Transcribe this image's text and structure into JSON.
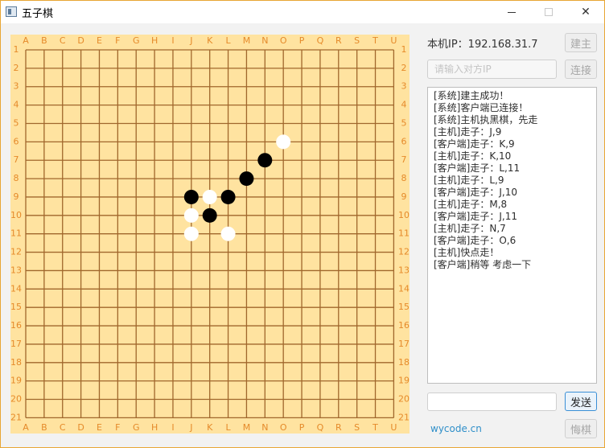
{
  "window": {
    "title": "五子棋",
    "minimize_icon": "minimize-icon",
    "maximize_icon": "maximize-icon",
    "close_icon": "close-icon",
    "close_glyph": "✕"
  },
  "board": {
    "columns": [
      "A",
      "B",
      "C",
      "D",
      "E",
      "F",
      "G",
      "H",
      "I",
      "J",
      "K",
      "L",
      "M",
      "N",
      "O",
      "P",
      "Q",
      "R",
      "S",
      "T",
      "U"
    ],
    "rows": [
      "1",
      "2",
      "3",
      "4",
      "5",
      "6",
      "7",
      "8",
      "9",
      "10",
      "11",
      "12",
      "13",
      "14",
      "15",
      "16",
      "17",
      "18",
      "19",
      "20",
      "21"
    ],
    "background_color": "#ffe3a0",
    "line_color": "#a0672c",
    "label_color": "#e58a2a",
    "stones": [
      {
        "color": "white",
        "col": "O",
        "row": 6
      },
      {
        "color": "black",
        "col": "N",
        "row": 7
      },
      {
        "color": "black",
        "col": "M",
        "row": 8
      },
      {
        "color": "black",
        "col": "J",
        "row": 9
      },
      {
        "color": "white",
        "col": "K",
        "row": 9
      },
      {
        "color": "black",
        "col": "L",
        "row": 9
      },
      {
        "color": "white",
        "col": "J",
        "row": 10
      },
      {
        "color": "black",
        "col": "K",
        "row": 10
      },
      {
        "color": "white",
        "col": "J",
        "row": 11
      },
      {
        "color": "white",
        "col": "L",
        "row": 11
      }
    ]
  },
  "sidebar": {
    "ip_label": "本机IP：192.168.31.7",
    "host_button": "建主",
    "ip_placeholder": "请输入对方IP",
    "connect_button": "连接",
    "log": [
      "[系统]建主成功！",
      "[系统]客户端已连接！",
      "[系统]主机执黑棋，先走",
      "[主机]走子：J,9",
      "[客户端]走子：K,9",
      "[主机]走子：K,10",
      "[客户端]走子：L,11",
      "[主机]走子：L,9",
      "[客户端]走子：J,10",
      "[主机]走子：M,8",
      "[客户端]走子：J,11",
      "[主机]走子：N,7",
      "[客户端]走子：O,6",
      "[主机]快点走！",
      "[客户端]稍等 考虑一下"
    ],
    "message_value": "",
    "send_button": "发送",
    "footer_link": "wycode.cn",
    "undo_button": "悔棋"
  }
}
